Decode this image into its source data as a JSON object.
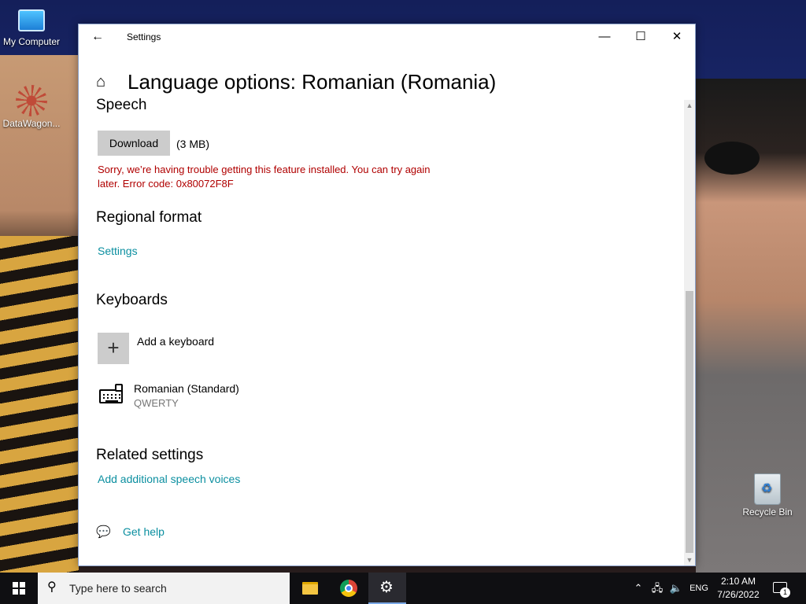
{
  "desktop": {
    "icons": [
      {
        "label": "My Computer"
      },
      {
        "label": "DataWagon..."
      },
      {
        "label": "Recycle Bin"
      }
    ]
  },
  "window": {
    "title": "Settings",
    "back_glyph": "←",
    "minimize_glyph": "—",
    "maximize_glyph": "☐",
    "close_glyph": "✕"
  },
  "page": {
    "title": "Language options: Romanian (Romania)",
    "home_glyph": "⌂"
  },
  "speech": {
    "heading": "Speech",
    "download_label": "Download",
    "size": "(3 MB)",
    "error": "Sorry, we’re having trouble getting this feature installed. You can try again later. Error code: 0x80072F8F"
  },
  "regional_format": {
    "heading": "Regional format",
    "settings_link": "Settings"
  },
  "keyboards": {
    "heading": "Keyboards",
    "add_label": "Add a keyboard",
    "add_glyph": "+",
    "items": [
      {
        "name": "Romanian (Standard)",
        "layout": "QWERTY"
      }
    ]
  },
  "related_settings": {
    "heading": "Related settings",
    "link": "Add additional speech voices"
  },
  "help": {
    "label": "Get help"
  },
  "taskbar": {
    "search_placeholder": "Type here to search",
    "language": "ENG",
    "time": "2:10 AM",
    "date": "7/26/2022",
    "notification_count": "1"
  },
  "colors": {
    "link": "#0b8fa0",
    "error": "#b00000",
    "taskbar": "#0f0f12"
  }
}
